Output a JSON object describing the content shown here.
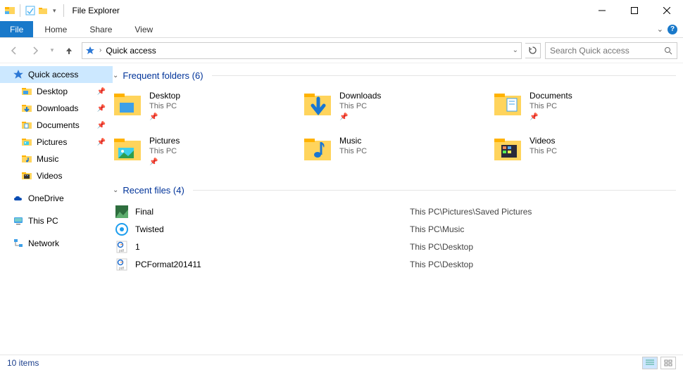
{
  "window": {
    "title": "File Explorer",
    "minimize_tip": "Minimize",
    "maximize_tip": "Maximize",
    "close_tip": "Close"
  },
  "ribbon": {
    "file": "File",
    "tabs": [
      "Home",
      "Share",
      "View"
    ]
  },
  "address": {
    "location": "Quick access",
    "search_placeholder": "Search Quick access"
  },
  "sidebar": {
    "sections": [
      {
        "items": [
          {
            "label": "Quick access",
            "icon": "star",
            "selected": true
          },
          {
            "label": "Desktop",
            "icon": "desktop",
            "pin": true,
            "indent": true
          },
          {
            "label": "Downloads",
            "icon": "downloads",
            "pin": true,
            "indent": true
          },
          {
            "label": "Documents",
            "icon": "documents",
            "pin": true,
            "indent": true
          },
          {
            "label": "Pictures",
            "icon": "pictures",
            "pin": true,
            "indent": true
          },
          {
            "label": "Music",
            "icon": "music",
            "indent": true
          },
          {
            "label": "Videos",
            "icon": "videos",
            "indent": true
          }
        ]
      },
      {
        "items": [
          {
            "label": "OneDrive",
            "icon": "onedrive"
          }
        ]
      },
      {
        "items": [
          {
            "label": "This PC",
            "icon": "thispc"
          }
        ]
      },
      {
        "items": [
          {
            "label": "Network",
            "icon": "network"
          }
        ]
      }
    ]
  },
  "frequent": {
    "heading": "Frequent folders (6)",
    "items": [
      {
        "name": "Desktop",
        "location": "This PC",
        "icon": "desktop-large",
        "pinned": true
      },
      {
        "name": "Downloads",
        "location": "This PC",
        "icon": "downloads-large",
        "pinned": true
      },
      {
        "name": "Documents",
        "location": "This PC",
        "icon": "documents-large",
        "pinned": true
      },
      {
        "name": "Pictures",
        "location": "This PC",
        "icon": "pictures-large",
        "pinned": true
      },
      {
        "name": "Music",
        "location": "This PC",
        "icon": "music-large",
        "pinned": false
      },
      {
        "name": "Videos",
        "location": "This PC",
        "icon": "videos-large",
        "pinned": false
      }
    ]
  },
  "recent": {
    "heading": "Recent files (4)",
    "items": [
      {
        "name": "Final",
        "path": "This PC\\Pictures\\Saved Pictures",
        "icon": "image"
      },
      {
        "name": "Twisted",
        "path": "This PC\\Music",
        "icon": "audio"
      },
      {
        "name": "1",
        "path": "This PC\\Desktop",
        "icon": "pdf"
      },
      {
        "name": "PCFormat201411",
        "path": "This PC\\Desktop",
        "icon": "pdf"
      }
    ]
  },
  "status": {
    "text": "10 items"
  }
}
